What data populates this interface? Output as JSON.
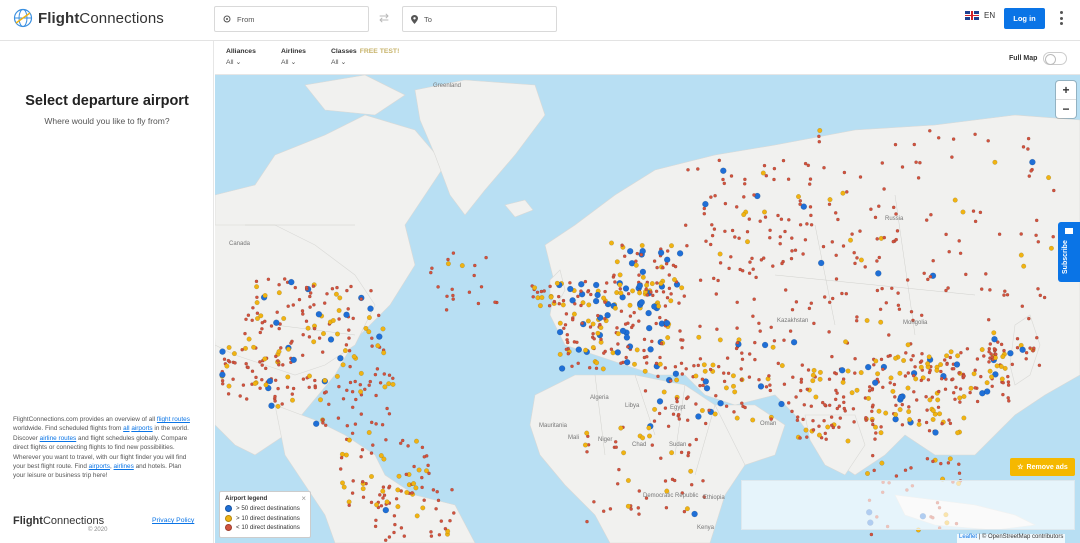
{
  "header": {
    "brand_bold": "Flight",
    "brand_rest": "Connections",
    "from_placeholder": "From",
    "to_placeholder": "To",
    "language": "EN",
    "login_label": "Log in"
  },
  "sidebar": {
    "title": "Select departure airport",
    "subtitle": "Where would you like to fly from?",
    "about": {
      "p1": "FlightConnections.com provides an overview of all",
      "link_flight_routes": "flight routes",
      "p2": "worldwide. Find scheduled flights from",
      "link_all": "all",
      "link_airports": "airports",
      "p3": "in the world. Discover",
      "link_airline_routes": "airline routes",
      "p4": "and flight schedules globally. Compare direct flights or connecting flights to find new possibilities. Wherever you want to travel, with our flight finder you will find your best flight route. Find",
      "link_airports2": "airports",
      "link_airlines": "airlines",
      "p5": "and hotels. Plan your leisure or business trip here!"
    },
    "footer_brand_bold": "Flight",
    "footer_brand_rest": "Connections",
    "footer_year": "© 2020",
    "privacy_label": "Privacy Policy"
  },
  "filters": {
    "alliances_label": "Alliances",
    "alliances_value": "All",
    "airlines_label": "Airlines",
    "airlines_value": "All",
    "classes_label": "Classes",
    "classes_tag": "FREE TEST!",
    "classes_value": "All",
    "fullmap_label": "Full Map"
  },
  "map": {
    "zoom_in": "+",
    "zoom_out": "−",
    "subscribe_label": "Subscribe",
    "remove_ads_label": "Remove ads",
    "legend": {
      "title": "Airport legend",
      "items": [
        {
          "label": "> 50 direct destinations",
          "color": "#1f6fd6"
        },
        {
          "label": "> 10 direct destinations",
          "color": "#f0b312"
        },
        {
          "label": "< 10 direct destinations",
          "color": "#d2533e"
        }
      ]
    },
    "attribution_leaflet": "Leaflet",
    "attribution_rest": "| © OpenStreetMap contributors",
    "labels": {
      "greenland": "Greenland",
      "canada": "Canada",
      "russia": "Russia",
      "kazakhstan": "Kazakhstan",
      "mongolia": "Mongolia",
      "libya": "Libya",
      "egypt": "Egypt",
      "mali": "Mali",
      "mauritania": "Mauritania",
      "niger": "Niger",
      "chad": "Chad",
      "sudan": "Sudan",
      "algeria": "Algeria",
      "oman": "Oman",
      "kenya": "Kenya",
      "drc": "Democratic Republic",
      "ethiopia": "Ethiopia"
    }
  }
}
